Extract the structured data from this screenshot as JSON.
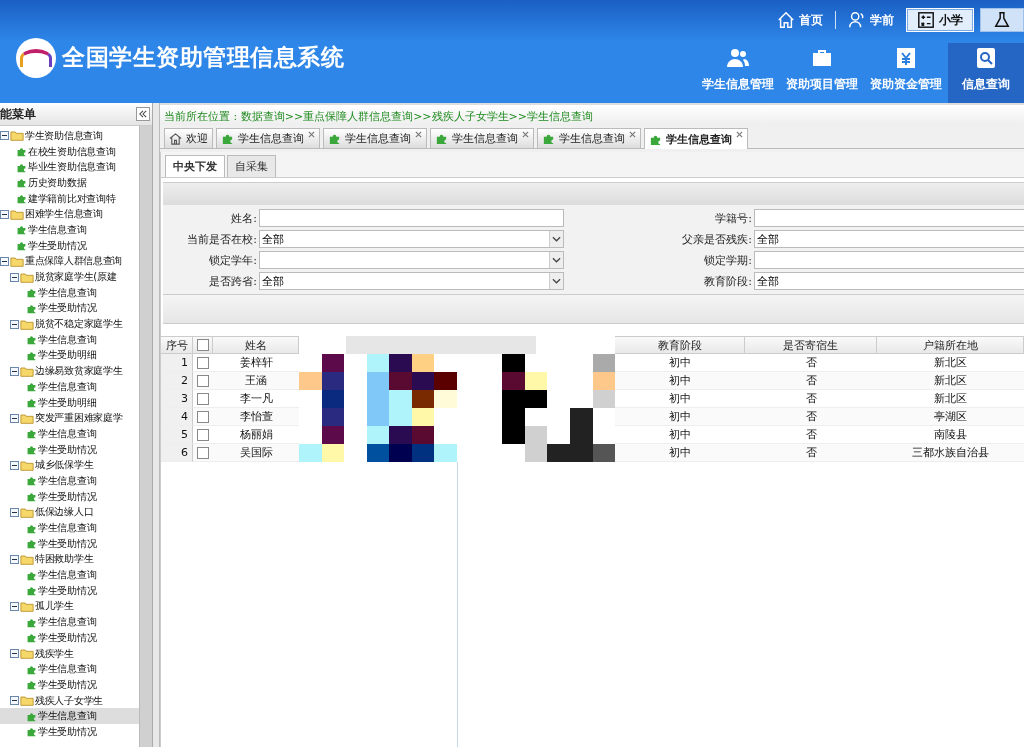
{
  "header": {
    "title": "全国学生资助管理信息系统",
    "top_links": [
      {
        "label": "首页",
        "kind": "link",
        "selected": false
      },
      {
        "label": "学前",
        "kind": "link",
        "selected": false
      },
      {
        "label": "小学",
        "kind": "button",
        "selected": true
      },
      {
        "kind": "icon",
        "selected": false
      }
    ],
    "nav": [
      {
        "label": "学生信息管理",
        "selected": false
      },
      {
        "label": "资助项目管理",
        "selected": false
      },
      {
        "label": "资助资金管理",
        "selected": false
      },
      {
        "label": "信息查询",
        "selected": true
      }
    ]
  },
  "sidebar": {
    "title": "能菜单",
    "items": [
      {
        "label": "学生资助信息查询",
        "expanded": true,
        "children": [
          {
            "label": "在校生资助信息查询",
            "selected": false
          },
          {
            "label": "毕业生资助信息查询",
            "selected": false
          },
          {
            "label": "历史资助数据",
            "selected": false
          },
          {
            "label": "建学籍前比对查询特",
            "selected": false
          }
        ]
      },
      {
        "label": "困难学生信息查询",
        "expanded": true,
        "children": [
          {
            "label": "学生信息查询",
            "selected": false
          },
          {
            "label": "学生受助情况",
            "selected": false
          }
        ]
      },
      {
        "label": "重点保障人群信息查询",
        "expanded": true,
        "children": [
          {
            "label": "脱贫家庭学生(原建",
            "expanded": true,
            "children": [
              {
                "label": "学生信息查询",
                "selected": false
              },
              {
                "label": "学生受助情况",
                "selected": false
              }
            ]
          },
          {
            "label": "脱贫不稳定家庭学生",
            "expanded": true,
            "children": [
              {
                "label": "学生信息查询",
                "selected": false
              },
              {
                "label": "学生受助明细",
                "selected": false
              }
            ]
          },
          {
            "label": "边缘易致贫家庭学生",
            "expanded": true,
            "children": [
              {
                "label": "学生信息查询",
                "selected": false
              },
              {
                "label": "学生受助明细",
                "selected": false
              }
            ]
          },
          {
            "label": "突发严重困难家庭学",
            "expanded": true,
            "children": [
              {
                "label": "学生信息查询",
                "selected": false
              },
              {
                "label": "学生受助情况",
                "selected": false
              }
            ]
          },
          {
            "label": "城乡低保学生",
            "expanded": true,
            "children": [
              {
                "label": "学生信息查询",
                "selected": false
              },
              {
                "label": "学生受助情况",
                "selected": false
              }
            ]
          },
          {
            "label": "低保边缘人口",
            "expanded": true,
            "children": [
              {
                "label": "学生信息查询",
                "selected": false
              },
              {
                "label": "学生受助情况",
                "selected": false
              }
            ]
          },
          {
            "label": "特困救助学生",
            "expanded": true,
            "children": [
              {
                "label": "学生信息查询",
                "selected": false
              },
              {
                "label": "学生受助情况",
                "selected": false
              }
            ]
          },
          {
            "label": "孤儿学生",
            "expanded": true,
            "children": [
              {
                "label": "学生信息查询",
                "selected": false
              },
              {
                "label": "学生受助情况",
                "selected": false
              }
            ]
          },
          {
            "label": "残疾学生",
            "expanded": true,
            "children": [
              {
                "label": "学生信息查询",
                "selected": false
              },
              {
                "label": "学生受助情况",
                "selected": false
              }
            ]
          },
          {
            "label": "残疾人子女学生",
            "expanded": true,
            "children": [
              {
                "label": "学生信息查询",
                "selected": true
              },
              {
                "label": "学生受助情况",
                "selected": false
              }
            ]
          }
        ]
      }
    ]
  },
  "breadcrumb": "当前所在位置 : 数据查询>>重点保障人群信息查询>>残疾人子女学生>>学生信息查询",
  "tabs": [
    {
      "label": "欢迎",
      "kind": "home",
      "selected": false
    },
    {
      "label": "学生信息查询",
      "kind": "page",
      "selected": false
    },
    {
      "label": "学生信息查询",
      "kind": "page",
      "selected": false
    },
    {
      "label": "学生信息查询",
      "kind": "page",
      "selected": false
    },
    {
      "label": "学生信息查询",
      "kind": "page",
      "selected": false
    },
    {
      "label": "学生信息查询",
      "kind": "page",
      "selected": true
    }
  ],
  "subtabs": [
    {
      "label": "中央下发",
      "selected": true
    },
    {
      "label": "自采集",
      "selected": false
    }
  ],
  "form": [
    {
      "label": "姓名:",
      "kind": "text"
    },
    {
      "label": "学籍号:",
      "kind": "text"
    },
    {
      "label": "当前是否在校:",
      "kind": "select",
      "value": "全部"
    },
    {
      "label": "父亲是否残疾:",
      "kind": "select",
      "value": "全部"
    },
    {
      "label": "锁定学年:",
      "kind": "select"
    },
    {
      "label": "锁定学期:",
      "kind": "text"
    },
    {
      "label": "是否跨省:",
      "kind": "select",
      "value": "全部"
    },
    {
      "label": "教育阶段:",
      "kind": "select",
      "value": "全部"
    }
  ],
  "table": {
    "all_checked": false,
    "columns": [
      "序号",
      "姓名",
      "教育阶段",
      "是否寄宿生",
      "户籍所在地"
    ],
    "rows": [
      {
        "index": "1",
        "checked": false,
        "name": "姜梓轩",
        "stage": "初中",
        "boarding": "否",
        "hometown": "新北区"
      },
      {
        "index": "2",
        "checked": false,
        "name": "王涵",
        "stage": "初中",
        "boarding": "否",
        "hometown": "新北区"
      },
      {
        "index": "3",
        "checked": false,
        "name": "李一凡",
        "stage": "初中",
        "boarding": "否",
        "hometown": "新北区"
      },
      {
        "index": "4",
        "checked": false,
        "name": "李怡萱",
        "stage": "初中",
        "boarding": "否",
        "hometown": "亭湖区"
      },
      {
        "index": "5",
        "checked": false,
        "name": "杨丽娟",
        "stage": "初中",
        "boarding": "否",
        "hometown": "南陵县"
      },
      {
        "index": "6",
        "checked": false,
        "name": "吴国际",
        "stage": "初中",
        "boarding": "否",
        "hometown": "三都水族自治县"
      }
    ]
  }
}
